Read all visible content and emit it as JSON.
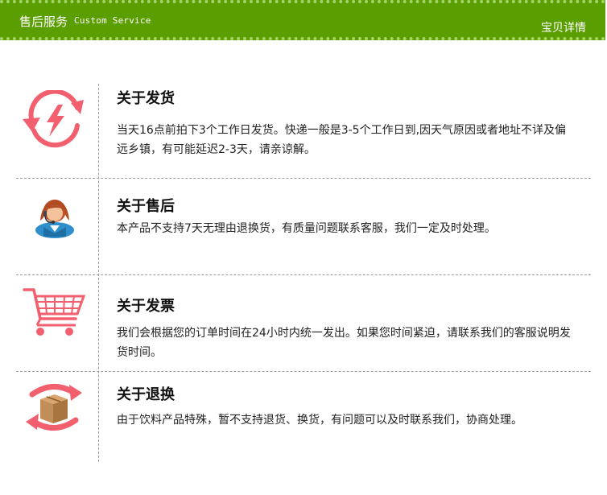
{
  "header": {
    "title": "售后服务",
    "subtitle": "Custom Service",
    "right_label": "宝贝详情"
  },
  "colors": {
    "header_bg": "#5a9e00",
    "accent_pink": "#f25f6f",
    "package_brown": "#c18e5a"
  },
  "sections": [
    {
      "icon": "refresh-lightning-icon",
      "title": "关于发货",
      "text": "当天16点前拍下3个工作日发货。快递一般是3-5个工作日到,因天气原因或者地址不详及偏远乡镇，有可能延迟2-3天，请亲谅解。"
    },
    {
      "icon": "customer-service-avatar-icon",
      "title": "关于售后",
      "text": "本产品不支持7天无理由退换货，有质量问题联系客服，我们一定及时处理。"
    },
    {
      "icon": "shopping-cart-icon",
      "title": "关于发票",
      "text": "我们会根据您的订单时间在24小时内统一发出。如果您时间紧迫，请联系我们的客服说明发货时间。"
    },
    {
      "icon": "package-exchange-icon",
      "title": "关于退换",
      "text": "由于饮料产品特殊，暂不支持退货、换货，有问题可以及时联系我们，协商处理。"
    }
  ]
}
